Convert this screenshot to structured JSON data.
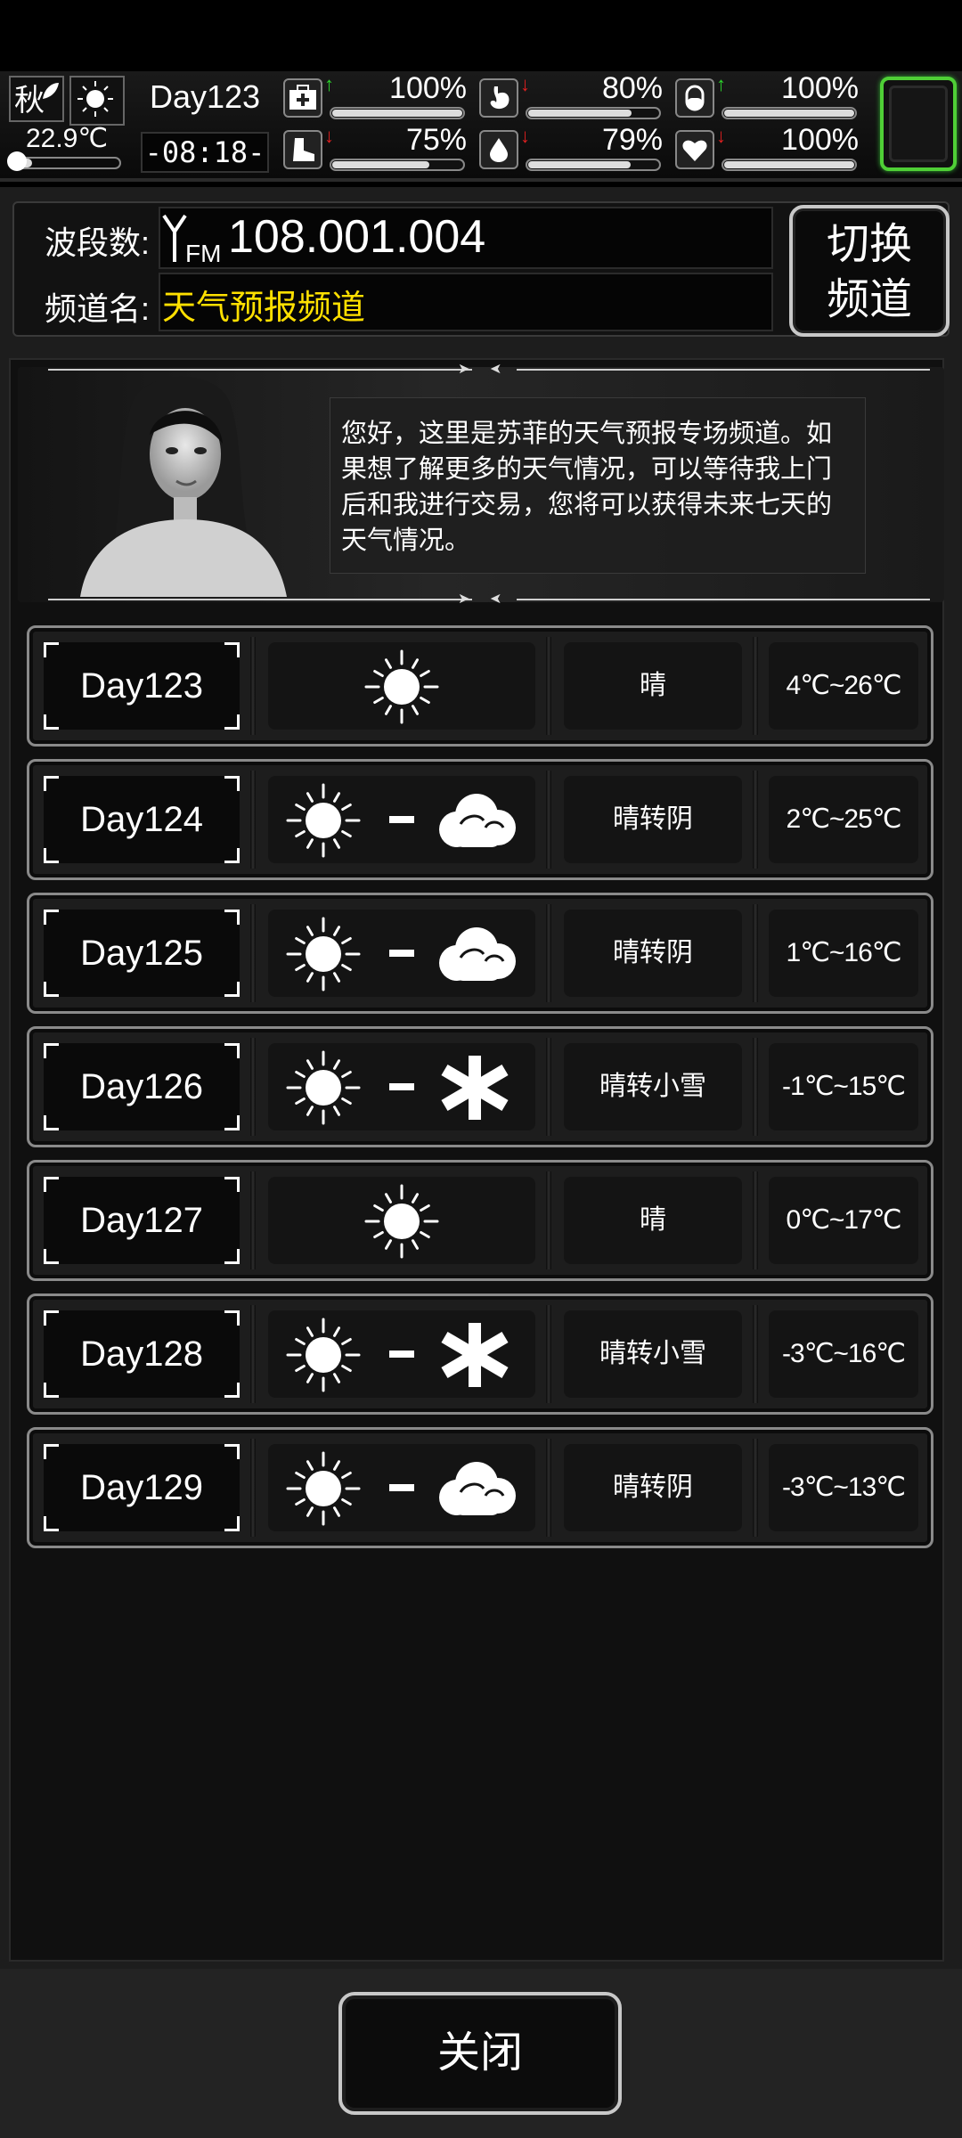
{
  "status": {
    "season": "秋",
    "temperature": "22.9℃",
    "temperature_level": 0.2,
    "day": "Day123",
    "time": "-08:18-",
    "stats": [
      {
        "icon": "medkit-icon",
        "trend": "up",
        "value": "100%",
        "level": 1.0
      },
      {
        "icon": "stomach-icon",
        "trend": "down",
        "value": "80%",
        "level": 0.8
      },
      {
        "icon": "pill-icon",
        "trend": "up",
        "value": "100%",
        "level": 1.0
      },
      {
        "icon": "boot-icon",
        "trend": "down",
        "value": "75%",
        "level": 0.75
      },
      {
        "icon": "water-drop-icon",
        "trend": "down",
        "value": "79%",
        "level": 0.79
      },
      {
        "icon": "heart-icon",
        "trend": "down",
        "value": "100%",
        "level": 1.0
      }
    ],
    "menu_accent": "#4fcf36"
  },
  "radio": {
    "band_label": "波段数:",
    "band_value": "108.001.004",
    "channel_label": "频道名:",
    "channel_value": "天气预报频道",
    "channel_color": "#ffe000",
    "switch_label_line1": "切换",
    "switch_label_line2": "频道",
    "fm_badge": "FM"
  },
  "intro": {
    "text": "您好，这里是苏菲的天气预报专场频道。如果想了解更多的天气情况，可以等待我上门后和我进行交易，您将可以获得未来七天的天气情况。"
  },
  "forecast": [
    {
      "day": "Day123",
      "icons": [
        "sun"
      ],
      "desc": "晴",
      "temp": "4℃~26℃"
    },
    {
      "day": "Day124",
      "icons": [
        "sun",
        "cloud"
      ],
      "desc": "晴转阴",
      "temp": "2℃~25℃"
    },
    {
      "day": "Day125",
      "icons": [
        "sun",
        "cloud"
      ],
      "desc": "晴转阴",
      "temp": "1℃~16℃"
    },
    {
      "day": "Day126",
      "icons": [
        "sun",
        "snow"
      ],
      "desc": "晴转小雪",
      "temp": "-1℃~15℃"
    },
    {
      "day": "Day127",
      "icons": [
        "sun"
      ],
      "desc": "晴",
      "temp": "0℃~17℃"
    },
    {
      "day": "Day128",
      "icons": [
        "sun",
        "snow"
      ],
      "desc": "晴转小雪",
      "temp": "-3℃~16℃"
    },
    {
      "day": "Day129",
      "icons": [
        "sun",
        "cloud"
      ],
      "desc": "晴转阴",
      "temp": "-3℃~13℃"
    }
  ],
  "footer": {
    "close_label": "关闭"
  }
}
